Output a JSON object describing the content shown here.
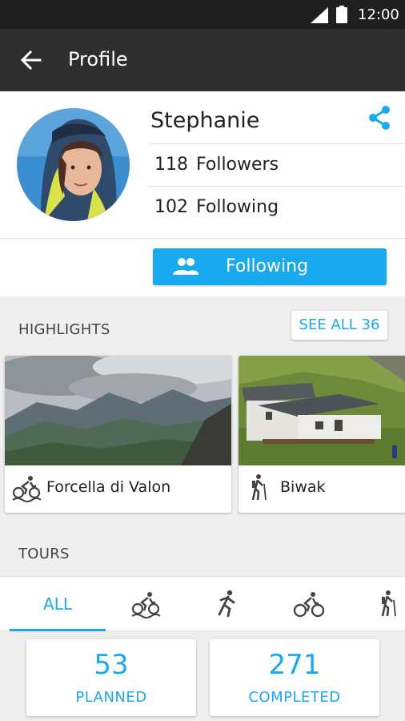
{
  "status_bar": {
    "time": "12:00",
    "signal_icon": "signal-icon",
    "battery_icon": "battery-icon"
  },
  "app_bar": {
    "back_icon": "arrow-back-icon",
    "title": "Profile"
  },
  "profile": {
    "name": "Stephanie",
    "followers_count": "118",
    "followers_label": "Followers",
    "following_count": "102",
    "following_label": "Following",
    "share_icon": "share-icon",
    "follow_button_label": "Following"
  },
  "highlights": {
    "section_title": "HIGHLIGHTS",
    "see_all_label": "SEE ALL 36",
    "cards": [
      {
        "title": "Forcella di Valon",
        "sport_icon": "mountain-bike-icon"
      },
      {
        "title": "Biwak",
        "sport_icon": "hiking-icon"
      }
    ]
  },
  "tours": {
    "section_title": "TOURS",
    "tabs": [
      {
        "label": "ALL",
        "selected": true
      },
      {
        "icon": "mountain-bike-icon"
      },
      {
        "icon": "running-icon"
      },
      {
        "icon": "road-bike-icon"
      },
      {
        "icon": "hiking-icon"
      }
    ],
    "planned_count": "53",
    "planned_label": "PLANNED",
    "completed_count": "271",
    "completed_label": "COMPLETED"
  },
  "colors": {
    "accent": "#19a9ef",
    "app_bar": "#2e2e2e",
    "status_bar": "#1f1f1f"
  }
}
